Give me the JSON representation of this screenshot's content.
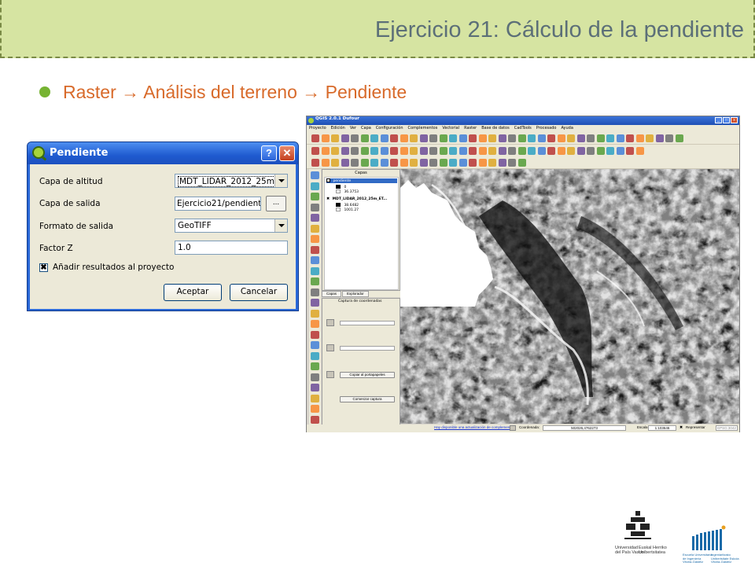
{
  "slide": {
    "title": "Ejercicio 21: Cálculo de la pendiente",
    "bullet": "Raster → Análisis del terreno → Pendiente",
    "colors": {
      "header_bg": "#d6e4a2",
      "title": "#5c6f78",
      "bullet_dot": "#76b332",
      "bullet_text": "#d86a2a"
    }
  },
  "dialog": {
    "title": "Pendiente",
    "help_label": "?",
    "close_label": "✕",
    "fields": {
      "altitude_label": "Capa de altitud",
      "altitude_value": "MDT_LIDAR_2012_25m_",
      "output_label": "Capa de salida",
      "output_value": "Ejercicio21/pendiente",
      "browse_label": "...",
      "format_label": "Formato de salida",
      "format_value": "GeoTIFF",
      "zfactor_label": "Factor Z",
      "zfactor_value": "1.0",
      "add_results_label": "Añadir resultados al proyecto",
      "add_results_checked": "✖"
    },
    "accept_label": "Aceptar",
    "cancel_label": "Cancelar"
  },
  "qgis": {
    "title": "QGIS 2.0.1 Dufour",
    "menus": [
      "Proyecto",
      "Edición",
      "Ver",
      "Capa",
      "Configuración",
      "Complementos",
      "Vectorial",
      "Raster",
      "Base de datos",
      "CadTools",
      "Procesado",
      "Ayuda"
    ],
    "layers_panel_title": "Capas",
    "layers": [
      {
        "name": "pendiente",
        "min": "0",
        "max": "36.3753"
      },
      {
        "name": "MDT_LIDAR_2012_25m_ET...",
        "min": "38.6482",
        "max": "1001.27"
      }
    ],
    "tabs": [
      "Capas",
      "Explorador"
    ],
    "coord_panel_title": "Captura de coordenadas",
    "copy_button": "Copiar al portapapeles",
    "start_capture_button": "Comenzar captura",
    "status": {
      "update_link": "Hay disponible una actualización de complemento",
      "coord_label": "Coordenada:",
      "coord_value": "502026,4762273",
      "scale_label": "Escala",
      "scale_value": "1:103646",
      "render_label": "Representar",
      "crs_label": "EPSG:3042"
    }
  },
  "logos": {
    "upv_line1": "Universidad",
    "upv_line2": "del País Vasco",
    "ehu_line1": "Euskal Herriko",
    "ehu_line2": "Unibertsitatea",
    "eui_line1": "Escuela Universitaria",
    "eui_line2": "de Ingeniería",
    "eui_line3": "Vitoria-Gasteiz",
    "ibi_line1": "Ingeniaritzako",
    "ibi_line2": "Unibertsitate Eskola",
    "ibi_line3": "Vitoria-Gasteiz"
  }
}
